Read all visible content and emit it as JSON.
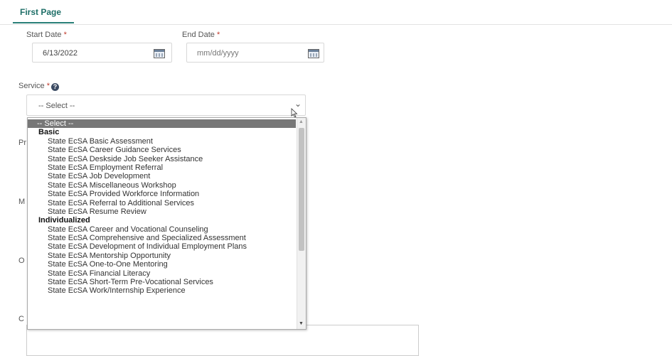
{
  "tabs": {
    "active": "First Page"
  },
  "start_date": {
    "label": "Start Date",
    "required_mark": "*",
    "value": "6/13/2022"
  },
  "end_date": {
    "label": "End Date",
    "required_mark": "*",
    "placeholder": "mm/dd/yyyy"
  },
  "service": {
    "label": "Service",
    "required_mark": "*",
    "help_icon": "?",
    "selected": "-- Select --",
    "chevron": "⌄"
  },
  "hidden_field_initials": [
    "Pr",
    "M",
    "O",
    "C"
  ],
  "dropdown": {
    "placeholder": "-- Select --",
    "groups": [
      {
        "label": "Basic",
        "options": [
          "State EcSA Basic Assessment",
          "State EcSA Career Guidance Services",
          "State EcSA Deskside Job Seeker Assistance",
          "State EcSA Employment Referral",
          "State EcSA Job Development",
          "State EcSA Miscellaneous Workshop",
          "State EcSA Provided Workforce Information",
          "State EcSA Referral to Additional Services",
          "State EcSA Resume Review"
        ]
      },
      {
        "label": "Individualized",
        "options": [
          "State EcSA Career and Vocational Counseling",
          "State EcSA Comprehensive and Specialized Assessment",
          "State EcSA Development of Individual Employment Plans",
          "State EcSA Mentorship Opportunity",
          "State EcSA One-to-One Mentoring",
          "State EcSA Financial Literacy",
          "State EcSA Short-Term Pre-Vocational Services",
          "State EcSA Work/Internship Experience"
        ]
      }
    ],
    "scrollbar": {
      "up_arrow": "▲",
      "down_arrow": "▼"
    }
  },
  "colors": {
    "accent": "#2a7f78",
    "required": "#c0392b",
    "highlight": "#777777"
  }
}
